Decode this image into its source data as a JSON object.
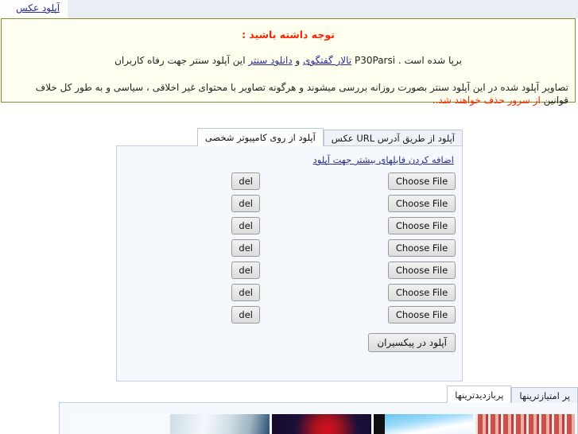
{
  "topbar": {
    "upload_link": "آپلود عکس"
  },
  "notice": {
    "title": "توجه داشته باشید :",
    "line1_before": "این آپلود سنتر جهت رفاه کاربران",
    "line1_link1": "دانلود سنتر",
    "line1_mid": "و",
    "line1_link2": "تالار گفتگوی",
    "line1_brand": "P30Parsi",
    "line1_after": "برپا شده است .",
    "line2_before": "تصاویر آپلود شده در این آپلود سنتر بصورت روزانه بررسی میشوند و هرگونه تصاویر با محتوای غیر اخلاقی ، سیاسی و به طور کل خلاف قوانین",
    "line2_red": "از سرور حذف خواهند شد..",
    "border_color": "#8a8a30",
    "background_color": "#fffff0",
    "title_color": "#ff2200"
  },
  "upload": {
    "tabs": [
      {
        "label": "آپلود از روی کامپیوتر شخصی",
        "active": true
      },
      {
        "label": "آپلود از طریق آدرس URL عکس",
        "active": false
      }
    ],
    "add_more_link": "اضافه کردن فایلهای بیشتر جهت آپلود",
    "rows": [
      {
        "choose_label": "Choose File",
        "del_label": "del"
      },
      {
        "choose_label": "Choose File",
        "del_label": "del"
      },
      {
        "choose_label": "Choose File",
        "del_label": "del"
      },
      {
        "choose_label": "Choose File",
        "del_label": "del"
      },
      {
        "choose_label": "Choose File",
        "del_label": "del"
      },
      {
        "choose_label": "Choose File",
        "del_label": "del"
      },
      {
        "choose_label": "Choose File",
        "del_label": "del"
      }
    ],
    "submit_label": "آپلود در پیکسیران"
  },
  "gallery": {
    "tabs": [
      {
        "label": "پربازدیدترینها",
        "active": true
      },
      {
        "label": "پر امتیازترینها",
        "active": false
      }
    ],
    "thumbs": [
      {
        "alt": "red-dancers-thumbnail"
      },
      {
        "alt": "blue-sky-feather-thumbnail"
      },
      {
        "alt": "red-rose-dark-thumbnail"
      },
      {
        "alt": "winter-snow-thumbnail"
      },
      {
        "alt": "empty-thumbnail"
      },
      {
        "alt": "empty-thumbnail"
      }
    ]
  }
}
